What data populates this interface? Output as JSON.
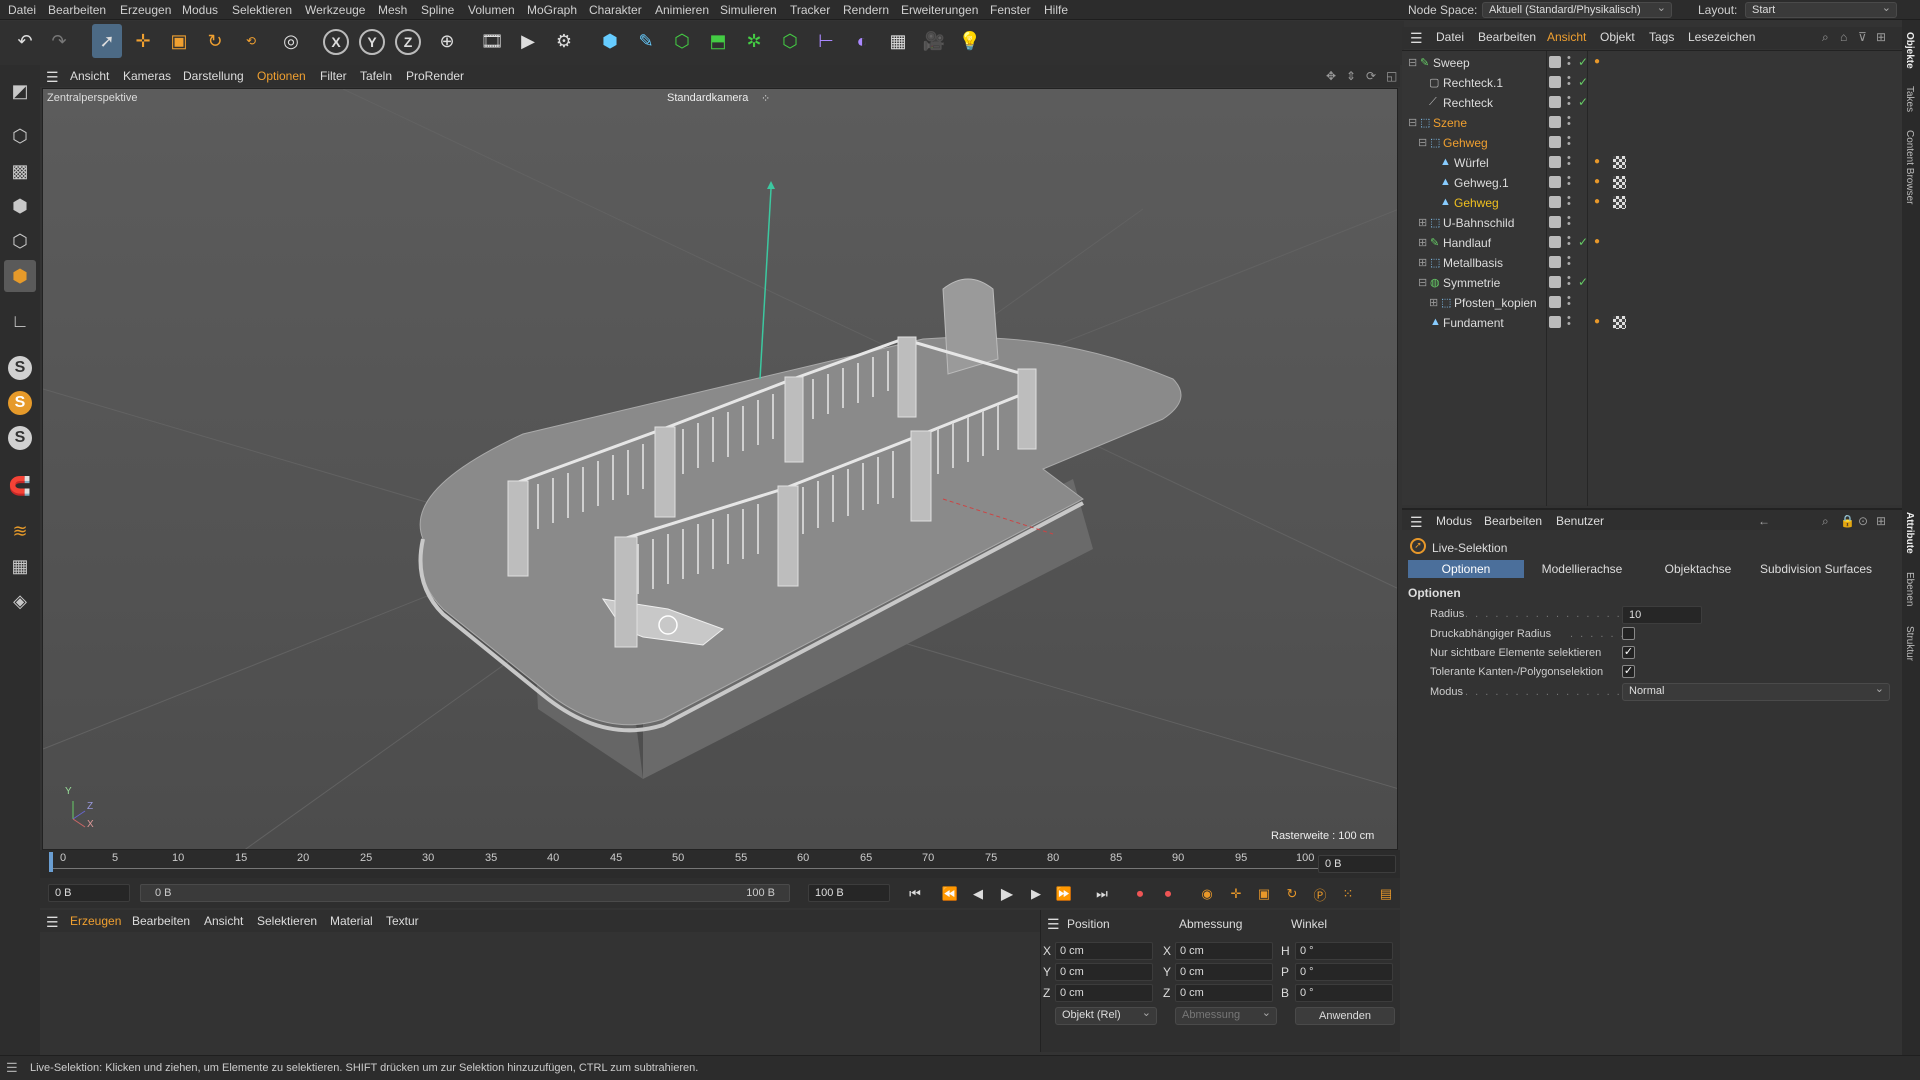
{
  "menubar": {
    "items": [
      "Datei",
      "Bearbeiten",
      "Erzeugen",
      "Modus",
      "Selektieren",
      "Werkzeuge",
      "Mesh",
      "Spline",
      "Volumen",
      "MoGraph",
      "Charakter",
      "Animieren",
      "Simulieren",
      "Tracker",
      "Rendern",
      "Erweiterungen",
      "Fenster",
      "Hilfe"
    ],
    "node_space_label": "Node Space:",
    "node_space_value": "Aktuell (Standard/Physikalisch)",
    "layout_label": "Layout:",
    "layout_value": "Start"
  },
  "toolbar": {
    "icons": [
      "undo-icon",
      "redo-icon",
      "live-selection-icon",
      "move-icon",
      "scale-icon",
      "rotate-icon",
      "psr-icon",
      "select-tool-icon",
      "x-axis-icon",
      "y-axis-icon",
      "z-axis-icon",
      "world-coord-icon",
      "render-region-icon",
      "render-view-icon",
      "render-settings-icon",
      "cube-icon",
      "pen-icon",
      "subdivision-icon",
      "extrude-icon",
      "array-icon",
      "cloner-icon",
      "symmetry-icon",
      "deformer-icon",
      "floor-icon",
      "camera-icon",
      "light-icon"
    ],
    "axis_x": "X",
    "axis_y": "Y",
    "axis_z": "Z"
  },
  "left_toolbar": {
    "icons": [
      "model-mode-icon",
      "texture-mode-icon",
      "points-mode-icon",
      "edges-mode-icon",
      "polygons-mode-icon",
      "axis-mode-icon",
      "snap-icon",
      "snap-settings-icon",
      "snap-grid-icon",
      "magnet-icon",
      "workplane-icon",
      "lock-workplane-icon",
      "quantize-icon"
    ],
    "s_label": "S"
  },
  "viewport": {
    "menu": [
      "Ansicht",
      "Kameras",
      "Darstellung",
      "Optionen",
      "Filter",
      "Tafeln",
      "ProRender"
    ],
    "selected_menu": "Optionen",
    "view_name": "Zentralperspektive",
    "camera_label": "Standardkamera",
    "grid_label": "Rasterweite : 100 cm",
    "axis_y": "Y",
    "axis_z": "Z",
    "axis_x": "X"
  },
  "timeline": {
    "ticks": [
      "0",
      "5",
      "10",
      "15",
      "20",
      "25",
      "30",
      "35",
      "40",
      "45",
      "50",
      "55",
      "60",
      "65",
      "70",
      "75",
      "80",
      "85",
      "90",
      "95",
      "100"
    ],
    "current_frame": "0 B"
  },
  "transport": {
    "start_field": "0 B",
    "range_start": "0 B",
    "range_end": "100 B",
    "end_field": "100 B"
  },
  "material_manager": {
    "menu": [
      "Erzeugen",
      "Bearbeiten",
      "Ansicht",
      "Selektieren",
      "Material",
      "Textur"
    ],
    "selected_menu": "Erzeugen"
  },
  "coord_manager": {
    "headers": [
      "Position",
      "Abmessung",
      "Winkel"
    ],
    "rows": [
      {
        "axis": "X",
        "pos": "0 cm",
        "size_axis": "X",
        "size": "0 cm",
        "rot_axis": "H",
        "rot": "0 °"
      },
      {
        "axis": "Y",
        "pos": "0 cm",
        "size_axis": "Y",
        "size": "0 cm",
        "rot_axis": "P",
        "rot": "0 °"
      },
      {
        "axis": "Z",
        "pos": "0 cm",
        "size_axis": "Z",
        "size": "0 cm",
        "rot_axis": "B",
        "rot": "0 °"
      }
    ],
    "mode_dropdown": "Objekt (Rel)",
    "size_dropdown": "Abmessung",
    "apply_button": "Anwenden"
  },
  "object_manager": {
    "menu": [
      "Datei",
      "Bearbeiten",
      "Ansicht",
      "Objekt",
      "Tags",
      "Lesezeichen"
    ],
    "selected_menu": "Ansicht",
    "objects": [
      {
        "name": "Sweep",
        "indent": 0,
        "color": "#dddddd",
        "icon": "sweep-icon"
      },
      {
        "name": "Rechteck.1",
        "indent": 1,
        "color": "#dddddd",
        "icon": "rectangle-spline-icon"
      },
      {
        "name": "Rechteck",
        "indent": 1,
        "color": "#dddddd",
        "icon": "spline-icon"
      },
      {
        "name": "Szene",
        "indent": 0,
        "color": "#f0a030",
        "icon": "null-icon"
      },
      {
        "name": "Gehweg",
        "indent": 1,
        "color": "#f0a030",
        "icon": "null-icon"
      },
      {
        "name": "Würfel",
        "indent": 2,
        "color": "#dddddd",
        "icon": "polygon-object-icon"
      },
      {
        "name": "Gehweg.1",
        "indent": 2,
        "color": "#dddddd",
        "icon": "polygon-object-icon"
      },
      {
        "name": "Gehweg",
        "indent": 2,
        "color": "#f0c020",
        "icon": "polygon-object-icon"
      },
      {
        "name": "U-Bahnschild",
        "indent": 1,
        "color": "#dddddd",
        "icon": "null-icon"
      },
      {
        "name": "Handlauf",
        "indent": 1,
        "color": "#dddddd",
        "icon": "sweep-icon"
      },
      {
        "name": "Metallbasis",
        "indent": 1,
        "color": "#dddddd",
        "icon": "null-icon"
      },
      {
        "name": "Symmetrie",
        "indent": 1,
        "color": "#dddddd",
        "icon": "symmetry-icon"
      },
      {
        "name": "Pfosten_kopien",
        "indent": 2,
        "color": "#dddddd",
        "icon": "null-icon"
      },
      {
        "name": "Fundament",
        "indent": 1,
        "color": "#dddddd",
        "icon": "polygon-object-icon"
      }
    ]
  },
  "attribute_manager": {
    "menu": [
      "Modus",
      "Bearbeiten",
      "Benutzer"
    ],
    "tool_name": "Live-Selektion",
    "tabs": [
      "Optionen",
      "Modellierachse",
      "Objektachse",
      "Subdivision Surfaces"
    ],
    "selected_tab": "Optionen",
    "section_title": "Optionen",
    "radius_label": "Radius",
    "radius_value": "10",
    "pressure_radius_label": "Druckabhängiger Radius",
    "pressure_radius_checked": false,
    "visible_only_label": "Nur sichtbare Elemente selektieren",
    "visible_only_checked": true,
    "tolerant_label": "Tolerante Kanten-/Polygonselektion",
    "tolerant_checked": true,
    "mode_label": "Modus",
    "mode_value": "Normal"
  },
  "right_tabs": [
    "Objekte",
    "Takes",
    "Content Browser",
    "Attribute",
    "Ebenen",
    "Struktur"
  ],
  "status_bar": {
    "text": "Live-Selektion: Klicken und ziehen, um Elemente zu selektieren. SHIFT drücken um zur Selektion hinzuzufügen, CTRL zum subtrahieren."
  },
  "colors": {
    "accent": "#f0a030",
    "selection_blue": "#4b6f9b"
  }
}
